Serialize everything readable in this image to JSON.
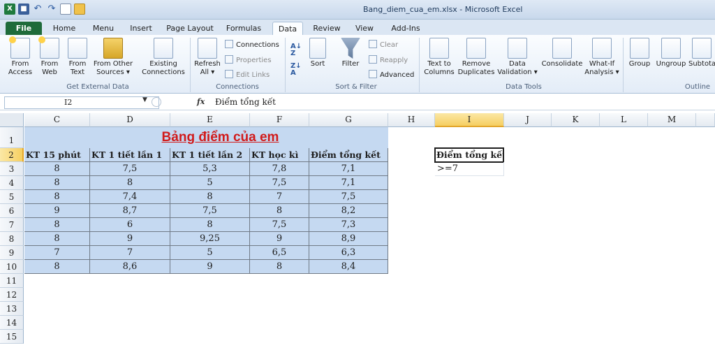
{
  "window": {
    "title": "Bang_diem_cua_em.xlsx - Microsoft Excel",
    "app_icon": "X"
  },
  "tabs": [
    "File",
    "Home",
    "Menu",
    "Insert",
    "Page Layout",
    "Formulas",
    "Data",
    "Review",
    "View",
    "Add-Ins"
  ],
  "active_tab": "Data",
  "ribbon": {
    "get_external": {
      "from_access": [
        "From",
        "Access"
      ],
      "from_web": [
        "From",
        "Web"
      ],
      "from_text": [
        "From",
        "Text"
      ],
      "from_other": [
        "From Other",
        "Sources ▾"
      ],
      "existing": [
        "Existing",
        "Connections"
      ],
      "label": "Get External Data"
    },
    "connections": {
      "refresh": [
        "Refresh",
        "All ▾"
      ],
      "connections": "Connections",
      "properties": "Properties",
      "edit_links": "Edit Links",
      "label": "Connections"
    },
    "sort_filter": {
      "sort": "Sort",
      "filter": "Filter",
      "clear": "Clear",
      "reapply": "Reapply",
      "advanced": "Advanced",
      "label": "Sort & Filter"
    },
    "data_tools": {
      "text_to_columns": [
        "Text to",
        "Columns"
      ],
      "remove_duplicates": [
        "Remove",
        "Duplicates"
      ],
      "data_validation": [
        "Data",
        "Validation ▾"
      ],
      "consolidate": "Consolidate",
      "what_if": [
        "What-If",
        "Analysis ▾"
      ],
      "label": "Data Tools"
    },
    "outline": {
      "group": "Group",
      "ungroup": "Ungroup",
      "subtotal": "Subtotal",
      "label": "Outline"
    }
  },
  "formula_bar": {
    "name_box": "I2",
    "fx": "fx",
    "value": "Điểm tổng kết"
  },
  "columns": [
    "C",
    "D",
    "E",
    "F",
    "G",
    "H",
    "I",
    "J",
    "K",
    "L",
    "M"
  ],
  "selected_column": "I",
  "rows": [
    "1",
    "2",
    "3",
    "4",
    "5",
    "6",
    "7",
    "8",
    "9",
    "10",
    "11",
    "12",
    "13",
    "14",
    "15"
  ],
  "selected_row": "2",
  "sheet": {
    "title": "Bảng điểm của em",
    "headers": [
      "KT 15 phút",
      "KT 1 tiết lần 1",
      "KT 1 tiết lần 2",
      "KT học kì",
      "Điểm tổng kết"
    ],
    "data": [
      [
        "8",
        "7,5",
        "5,3",
        "7,8",
        "7,1"
      ],
      [
        "8",
        "8",
        "5",
        "7,5",
        "7,1"
      ],
      [
        "8",
        "7,4",
        "8",
        "7",
        "7,5"
      ],
      [
        "9",
        "8,7",
        "7,5",
        "8",
        "8,2"
      ],
      [
        "8",
        "6",
        "8",
        "7,5",
        "7,3"
      ],
      [
        "8",
        "9",
        "9,25",
        "9",
        "8,9"
      ],
      [
        "7",
        "7",
        "5",
        "6,5",
        "6,3"
      ],
      [
        "8",
        "8,6",
        "9",
        "8",
        "8,4"
      ]
    ],
    "criteria_header": "Điểm tổng kết",
    "criteria_value": ">=7"
  },
  "colors": {
    "table_fill": "#c5d9f1",
    "title_color": "#d11b1b",
    "file_tab": "#1f6b3a"
  }
}
